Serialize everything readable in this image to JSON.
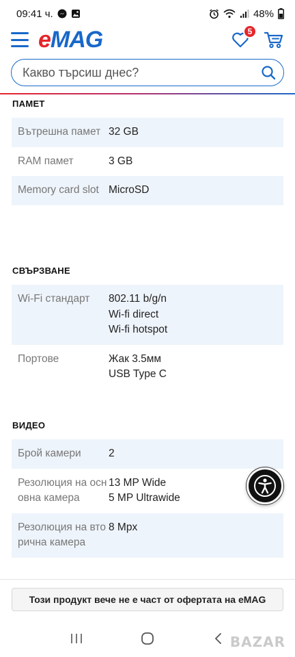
{
  "status_bar": {
    "time": "09:41 ч.",
    "battery": "48%",
    "icons": [
      "messenger-icon",
      "gallery-icon",
      "alarm-icon",
      "wifi-icon",
      "signal-icon",
      "battery-icon"
    ]
  },
  "header": {
    "logo_e": "e",
    "logo_mag": "MAG",
    "favorites_count": "5"
  },
  "search": {
    "placeholder": "Какво търсиш днес?"
  },
  "colors": {
    "brand_blue": "#1868c9",
    "brand_red": "#e6252b",
    "row_alt": "#eef4fb"
  },
  "sections": [
    {
      "title": "ПАМЕТ",
      "rows": [
        {
          "label": "Вътрешна памет",
          "values": [
            "32 GB"
          ]
        },
        {
          "label": "RAM памет",
          "values": [
            "3 GB"
          ]
        },
        {
          "label": "Memory card slot",
          "values": [
            "MicroSD"
          ]
        }
      ]
    },
    {
      "title": "СВЪРЗВАНЕ",
      "rows": [
        {
          "label": "Wi-Fi стандарт",
          "values": [
            "802.11 b/g/n",
            "Wi-fi direct",
            "Wi-fi hotspot"
          ]
        },
        {
          "label": "Портове",
          "values": [
            "Жак 3.5мм",
            "USB Type C"
          ]
        }
      ]
    },
    {
      "title": "ВИДЕО",
      "rows": [
        {
          "label": "Брой камери",
          "values": [
            "2"
          ]
        },
        {
          "label": "Резолюция на основна камера",
          "values": [
            "13 MP Wide",
            "5 MP Ultrawide"
          ]
        },
        {
          "label": "Резолюция на вторична камера",
          "values": [
            "8 Mpx"
          ]
        }
      ]
    }
  ],
  "banner": {
    "text": "Този продукт вече не е част от офертата на eMAG"
  },
  "watermark": "BAZAR"
}
